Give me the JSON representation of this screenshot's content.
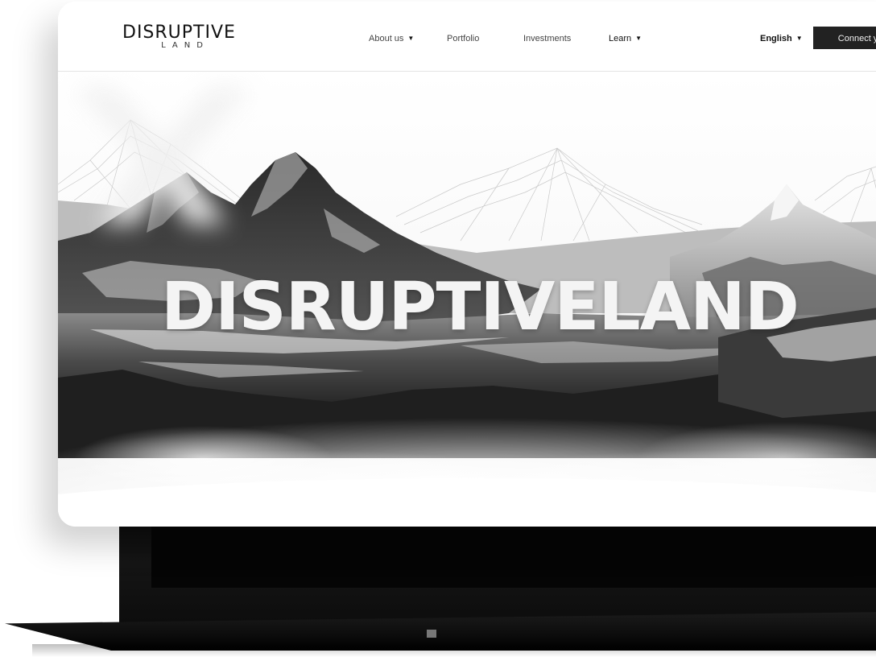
{
  "brand": {
    "logo_main": "DISRUPTIVE",
    "logo_sub": "LAND"
  },
  "nav": {
    "items": [
      {
        "label": "About us",
        "has_dropdown": true
      },
      {
        "label": "Portfolio",
        "has_dropdown": false
      },
      {
        "label": "Investments",
        "has_dropdown": false
      },
      {
        "label": "Learn",
        "has_dropdown": true
      }
    ],
    "language": "English",
    "connect_label": "Connect your"
  },
  "hero": {
    "title": "DISRUPTIVELAND"
  },
  "icons": {
    "dropdown": "chevron-down-icon",
    "hero_mark": "x-mark-icon"
  },
  "colors": {
    "button_bg": "#222222",
    "nav_text": "#444444",
    "hero_title": "#f4f4f4"
  }
}
